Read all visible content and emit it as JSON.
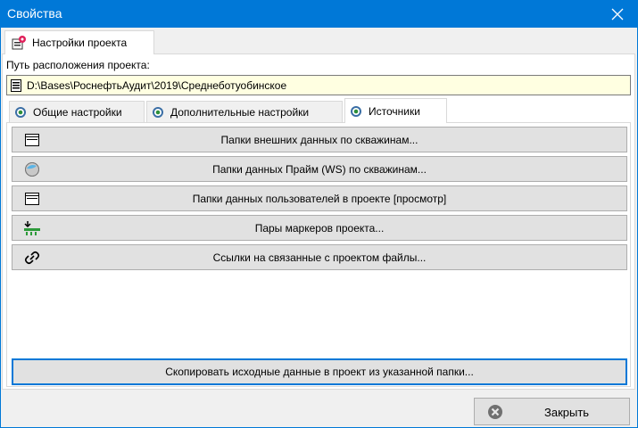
{
  "window": {
    "title": "Свойства"
  },
  "outer_tab": {
    "label": "Настройки проекта"
  },
  "project_path": {
    "label": "Путь расположения проекта:",
    "value": "D:\\Bases\\РоснефтьАудит\\2019\\Среднеботуобинское"
  },
  "inner_tabs": [
    {
      "label": "Общие настройки",
      "active": false
    },
    {
      "label": "Дополнительные настройки",
      "active": false
    },
    {
      "label": "Источники",
      "active": true
    }
  ],
  "source_buttons": [
    {
      "label": "Папки внешних данных по скважинам...",
      "icon": "folder-box-icon"
    },
    {
      "label": "Папки данных Прайм (WS) по скважинам...",
      "icon": "ws-globe-icon"
    },
    {
      "label": "Папки данных пользователей в проекте [просмотр]",
      "icon": "folder-box-icon"
    },
    {
      "label": "Пары маркеров проекта...",
      "icon": "marker-pairs-icon"
    },
    {
      "label": "Ссылки на связанные с проектом файлы...",
      "icon": "link-icon"
    }
  ],
  "copy_button": {
    "label": "Скопировать исходные данные в проект из указанной папки..."
  },
  "close_button": {
    "label": "Закрыть"
  },
  "colors": {
    "titlebar": "#0078d7",
    "path_bg": "#ffffe1",
    "button_bg": "#e1e1e1",
    "focus": "#0078d7"
  }
}
